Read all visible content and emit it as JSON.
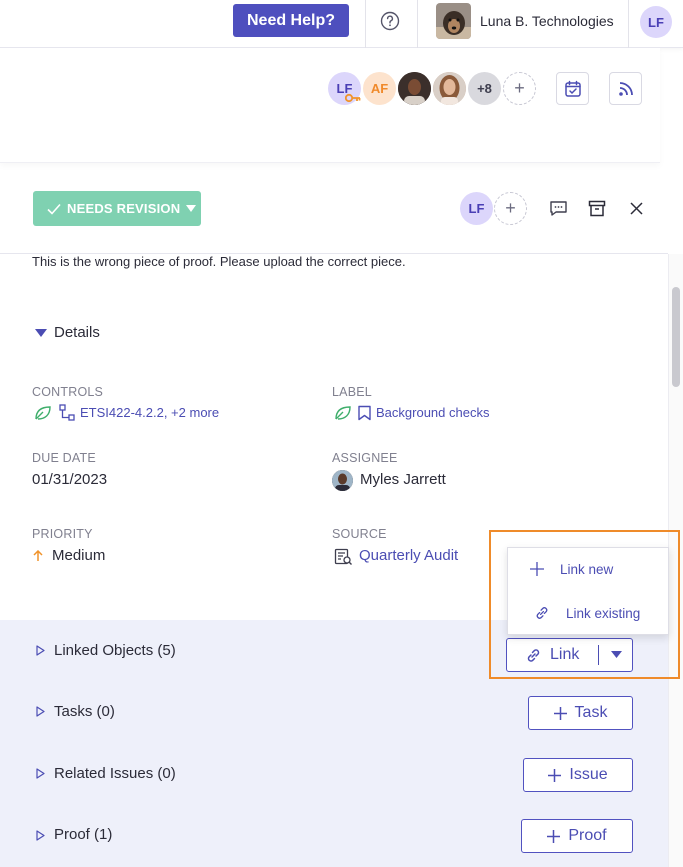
{
  "topbar": {
    "help_label": "Need Help?",
    "org_name": "Luna B. Technologies",
    "user_initials": "LF"
  },
  "page_header": {
    "collaborators": [
      {
        "initials": "LF"
      },
      {
        "initials": "AF"
      }
    ],
    "more_count": "+8"
  },
  "drawer": {
    "status_label": "NEEDS REVISION",
    "assignee_initials": "LF",
    "description": "This is the wrong piece of proof. Please upload the correct piece.",
    "details_title": "Details",
    "fields": {
      "controls": {
        "label": "CONTROLS",
        "value": "ETSI422-4.2.2, +2 more"
      },
      "label": {
        "label": "LABEL",
        "value": "Background checks"
      },
      "due_date": {
        "label": "DUE DATE",
        "value": "01/31/2023"
      },
      "assignee": {
        "label": "ASSIGNEE",
        "value": "Myles Jarrett"
      },
      "priority": {
        "label": "PRIORITY",
        "value": "Medium"
      },
      "source": {
        "label": "SOURCE",
        "value": "Quarterly Audit"
      }
    }
  },
  "sections": {
    "linked_objects": {
      "title": "Linked Objects (5)",
      "button": "Link"
    },
    "tasks": {
      "title": "Tasks (0)",
      "button": "Task"
    },
    "related_issues": {
      "title": "Related Issues (0)",
      "button": "Issue"
    },
    "proof": {
      "title": "Proof (1)",
      "button": "Proof"
    }
  },
  "link_menu": {
    "items": [
      {
        "label": "Link new"
      },
      {
        "label": "Link existing"
      }
    ]
  },
  "colors": {
    "accent": "#4e4fbe",
    "status_green": "#7fd1b1",
    "highlight_orange": "#ef8b2a",
    "priority_orange": "#f0932b"
  }
}
